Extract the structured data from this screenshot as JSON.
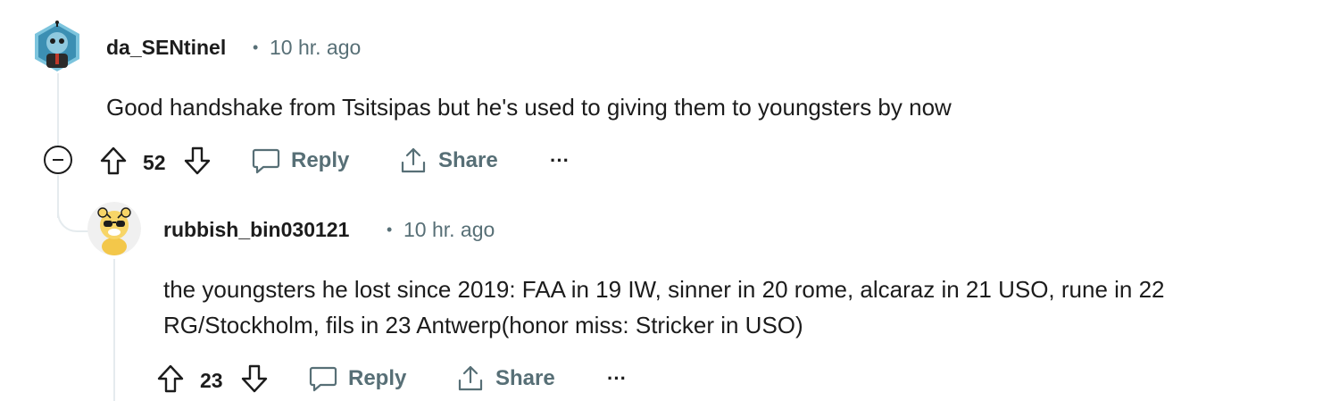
{
  "comments": [
    {
      "username": "da_SENtinel",
      "separator": "•",
      "time": "10 hr. ago",
      "body": "Good handshake from Tsitsipas but he's used to giving them to youngsters by now",
      "score": "52",
      "reply_label": "Reply",
      "share_label": "Share",
      "more_label": "···"
    },
    {
      "username": "rubbish_bin030121",
      "separator": "•",
      "time": "10 hr. ago",
      "body_line1": "the youngsters he lost since 2019: FAA in 19 IW, sinner in 20 rome, alcaraz in 21 USO, rune in 22",
      "body_line2": "RG/Stockholm, fils in 23 Antwerp(honor miss: Stricker in USO)",
      "score": "23",
      "reply_label": "Reply",
      "share_label": "Share",
      "more_label": "···"
    }
  ],
  "colors": {
    "text": "#1c1c1c",
    "meta": "#576f76",
    "thread_line": "#e5ebee",
    "avatar1_bg": "#4aa3c9",
    "avatar2_bg": "#f0f0f0"
  },
  "icons": {
    "upvote": "arrow-up-outline",
    "downvote": "arrow-down-outline",
    "reply": "speech-bubble",
    "share": "share-arrow",
    "collapse": "minus-circle"
  }
}
